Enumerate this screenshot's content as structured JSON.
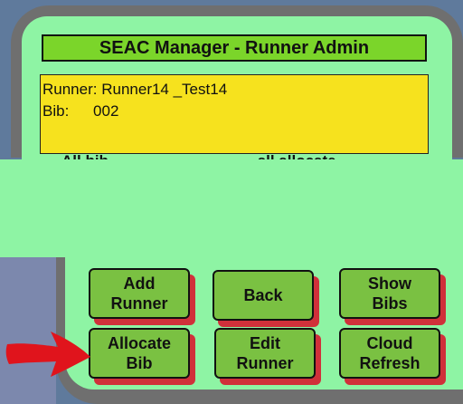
{
  "header": {
    "title": "SEAC Manager - Runner Admin"
  },
  "runner_info": {
    "runner_label": "Runner:",
    "runner_value": "Runner14 _Test14",
    "bib_label": "Bib:",
    "bib_value": "002"
  },
  "truncated_text": {
    "left": "All bib",
    "right": "all allocate"
  },
  "buttons": {
    "add_runner": {
      "line1": "Add",
      "line2": "Runner"
    },
    "back": {
      "line1": "Back"
    },
    "show_bibs": {
      "line1": "Show",
      "line2": "Bibs"
    },
    "allocate_bib": {
      "line1": "Allocate",
      "line2": "Bib"
    },
    "edit_runner": {
      "line1": "Edit",
      "line2": "Runner"
    },
    "cloud_refresh": {
      "line1": "Cloud",
      "line2": "Refresh"
    }
  },
  "colors": {
    "background": "#5f7a9c",
    "panel_green": "#8ef4a4",
    "title_green": "#7bd52a",
    "info_yellow": "#f6e21e",
    "button_green": "#7ac142",
    "button_shadow_red": "#d0303a",
    "arrow_red": "#e0141c",
    "frame_gray": "#6f6f6f"
  }
}
